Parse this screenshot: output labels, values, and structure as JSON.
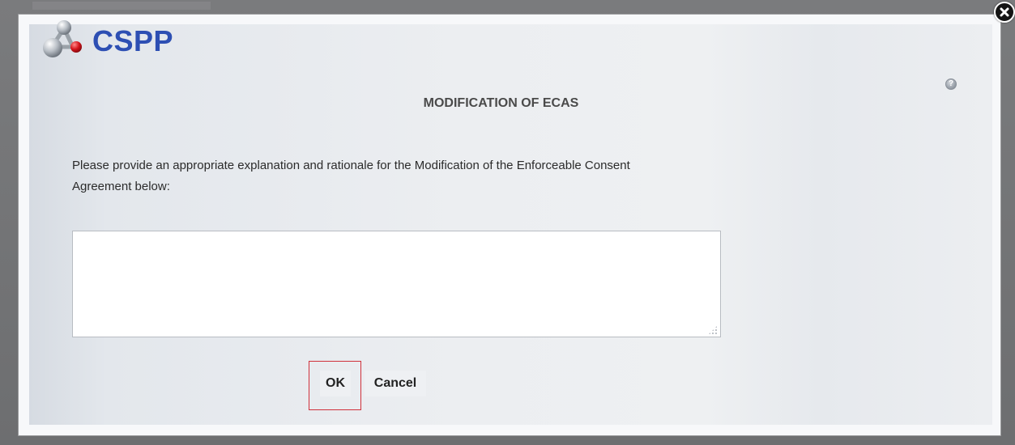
{
  "header": {
    "logo_text": "CSPP",
    "logo_icon": "molecule-icon"
  },
  "dialog": {
    "title": "MODIFICATION OF ECAS",
    "instructions": "Please provide an appropriate explanation and rationale for the Modification of the Enforceable Consent Agreement below:",
    "textarea_value": "",
    "ok_label": "OK",
    "cancel_label": "Cancel",
    "help_icon": "help-icon",
    "close_icon": "close-icon"
  },
  "colors": {
    "brand": "#2d4fb3",
    "highlight": "#d0313b"
  }
}
